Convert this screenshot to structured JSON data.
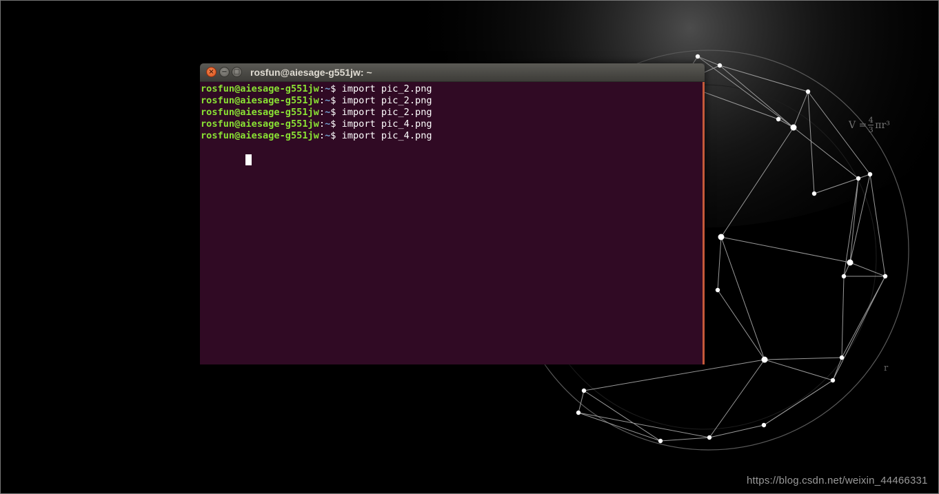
{
  "window": {
    "title": "rosfun@aiesage-g551jw: ~"
  },
  "terminal": {
    "lines": [
      {
        "user_host": "rosfun@aiesage-g551jw",
        "separator": ":",
        "path": "~",
        "symbol": "$ ",
        "command": "import pic_2.png"
      },
      {
        "user_host": "rosfun@aiesage-g551jw",
        "separator": ":",
        "path": "~",
        "symbol": "$ ",
        "command": "import pic_2.png"
      },
      {
        "user_host": "rosfun@aiesage-g551jw",
        "separator": ":",
        "path": "~",
        "symbol": "$ ",
        "command": "import pic_2.png"
      },
      {
        "user_host": "rosfun@aiesage-g551jw",
        "separator": ":",
        "path": "~",
        "symbol": "$ ",
        "command": "import pic_4.png"
      },
      {
        "user_host": "rosfun@aiesage-g551jw",
        "separator": ":",
        "path": "~",
        "symbol": "$ ",
        "command": "import pic_4.png"
      }
    ]
  },
  "wallpaper": {
    "formula_prefix": "V =",
    "formula_numerator": "4",
    "formula_denominator": "3",
    "formula_suffix": "πr³",
    "radius_label": "r"
  },
  "watermark": "https://blog.csdn.net/weixin_44466331",
  "colors": {
    "terminal_bg": "#300a24",
    "prompt_user": "#8ae234",
    "prompt_path": "#729fcf",
    "close_button": "#e2602a",
    "titlebar": "#4a4945"
  },
  "icons": {
    "close": "close-icon",
    "minimize": "minimize-icon",
    "maximize": "maximize-icon"
  }
}
